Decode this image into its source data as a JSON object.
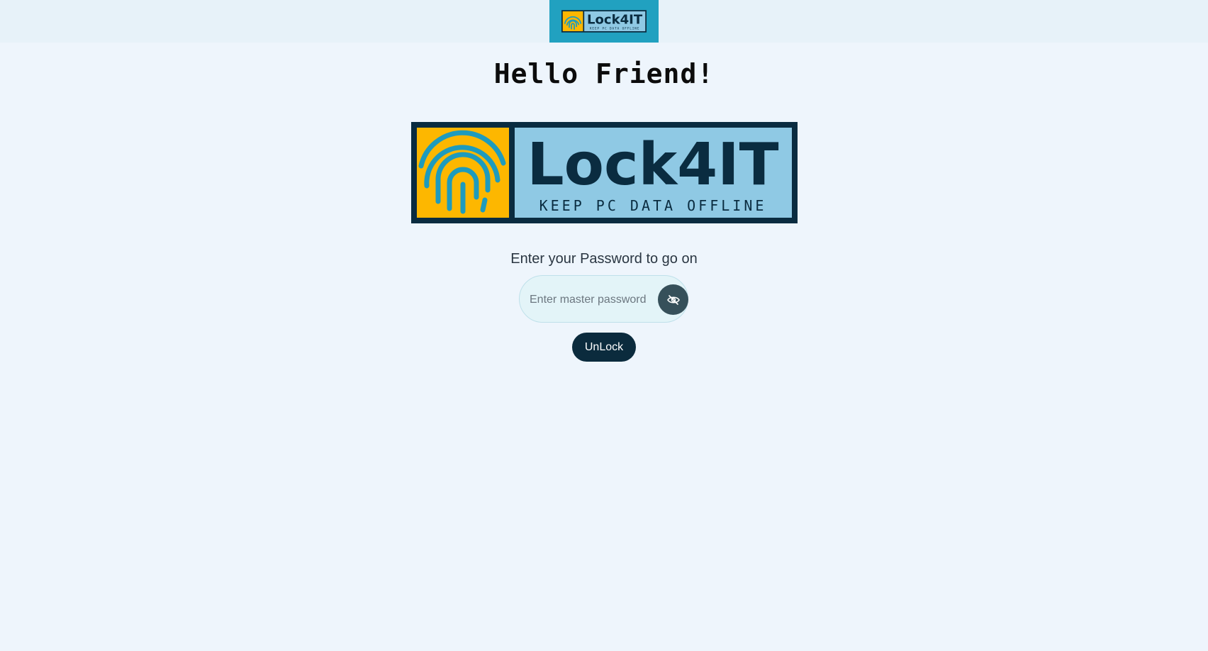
{
  "header": {
    "logo_alt": "Lock4IT"
  },
  "main": {
    "greeting": "Hello Friend!",
    "logo": {
      "name": "Lock4IT",
      "tagline": "KEEP PC DATA OFFLINE",
      "colors": {
        "frame": "#0a2c40",
        "fingerprint_bg": "#fdb700",
        "fingerprint": "#1e9bbd",
        "text_bg": "#8fc9e4",
        "text": "#0a2c40"
      }
    },
    "prompt": "Enter your Password to go on",
    "password": {
      "value": "",
      "placeholder": "Enter master password",
      "toggle_icon": "eye-slash-icon"
    },
    "unlock_label": "UnLock"
  },
  "colors": {
    "background": "#eef5fc",
    "topbar": "#e7f2f9",
    "top_tab": "#21a1c0",
    "button": "#0b2b3d"
  }
}
